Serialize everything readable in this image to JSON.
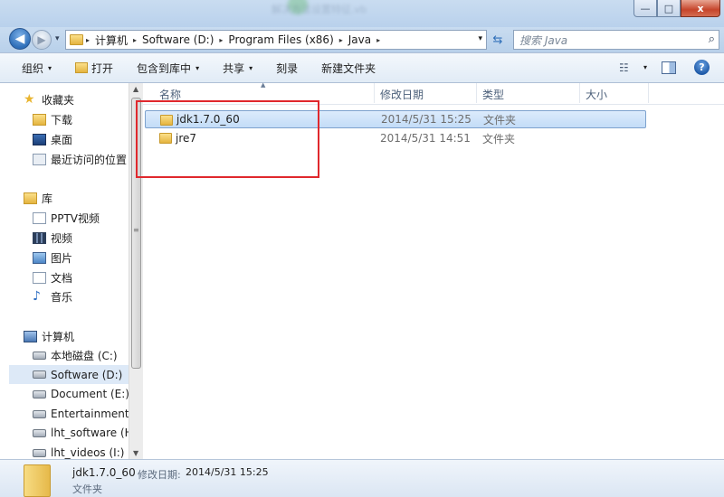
{
  "window": {
    "ghost_title": "解决方法设置特征.vb",
    "controls": {
      "minimize": "—",
      "maximize": "□",
      "close": "x"
    }
  },
  "nav": {
    "back": "◀",
    "forward": "▶",
    "history": "▾",
    "breadcrumbs": [
      "计算机",
      "Software (D:)",
      "Program Files (x86)",
      "Java"
    ],
    "crumb_separator": "▸",
    "refresh": "⇆",
    "search_placeholder": "搜索 Java",
    "search_icon": "⌕"
  },
  "toolbar": {
    "organize": "组织",
    "open": "打开",
    "include_library": "包含到库中",
    "share": "共享",
    "burn": "刻录",
    "new_folder": "新建文件夹",
    "dropdown_arrow": "▾",
    "view_icon": "☷",
    "help": "?"
  },
  "sidebar": {
    "favorites": {
      "label": "收藏夹",
      "items": [
        "下载",
        "桌面",
        "最近访问的位置"
      ]
    },
    "libraries": {
      "label": "库",
      "items": [
        "PPTV视频",
        "视频",
        "图片",
        "文档",
        "音乐"
      ]
    },
    "computer": {
      "label": "计算机",
      "items": [
        "本地磁盘 (C:)",
        "Software (D:)",
        "Document (E:)",
        "Entertainment (",
        "lht_software (H:",
        "lht_videos (I:)"
      ]
    },
    "selected": "Software (D:)",
    "star_icon": "★",
    "music_icon": "♪"
  },
  "columns": {
    "name": "名称",
    "date": "修改日期",
    "type": "类型",
    "size": "大小",
    "sort_arrow": "▲"
  },
  "files": [
    {
      "name": "jdk1.7.0_60",
      "date": "2014/5/31 15:25",
      "type": "文件夹",
      "size": ""
    },
    {
      "name": "jre7",
      "date": "2014/5/31 14:51",
      "type": "文件夹",
      "size": ""
    }
  ],
  "details": {
    "name": "jdk1.7.0_60",
    "date_label": "修改日期:",
    "date": "2014/5/31 15:25",
    "type": "文件夹"
  },
  "scrollbar": {
    "up": "▲",
    "down": "▼",
    "grip": "≡"
  },
  "colors": {
    "highlight_box": "#e0282d",
    "selection": "#c3dcf7",
    "chrome": "#c9dcf0"
  }
}
